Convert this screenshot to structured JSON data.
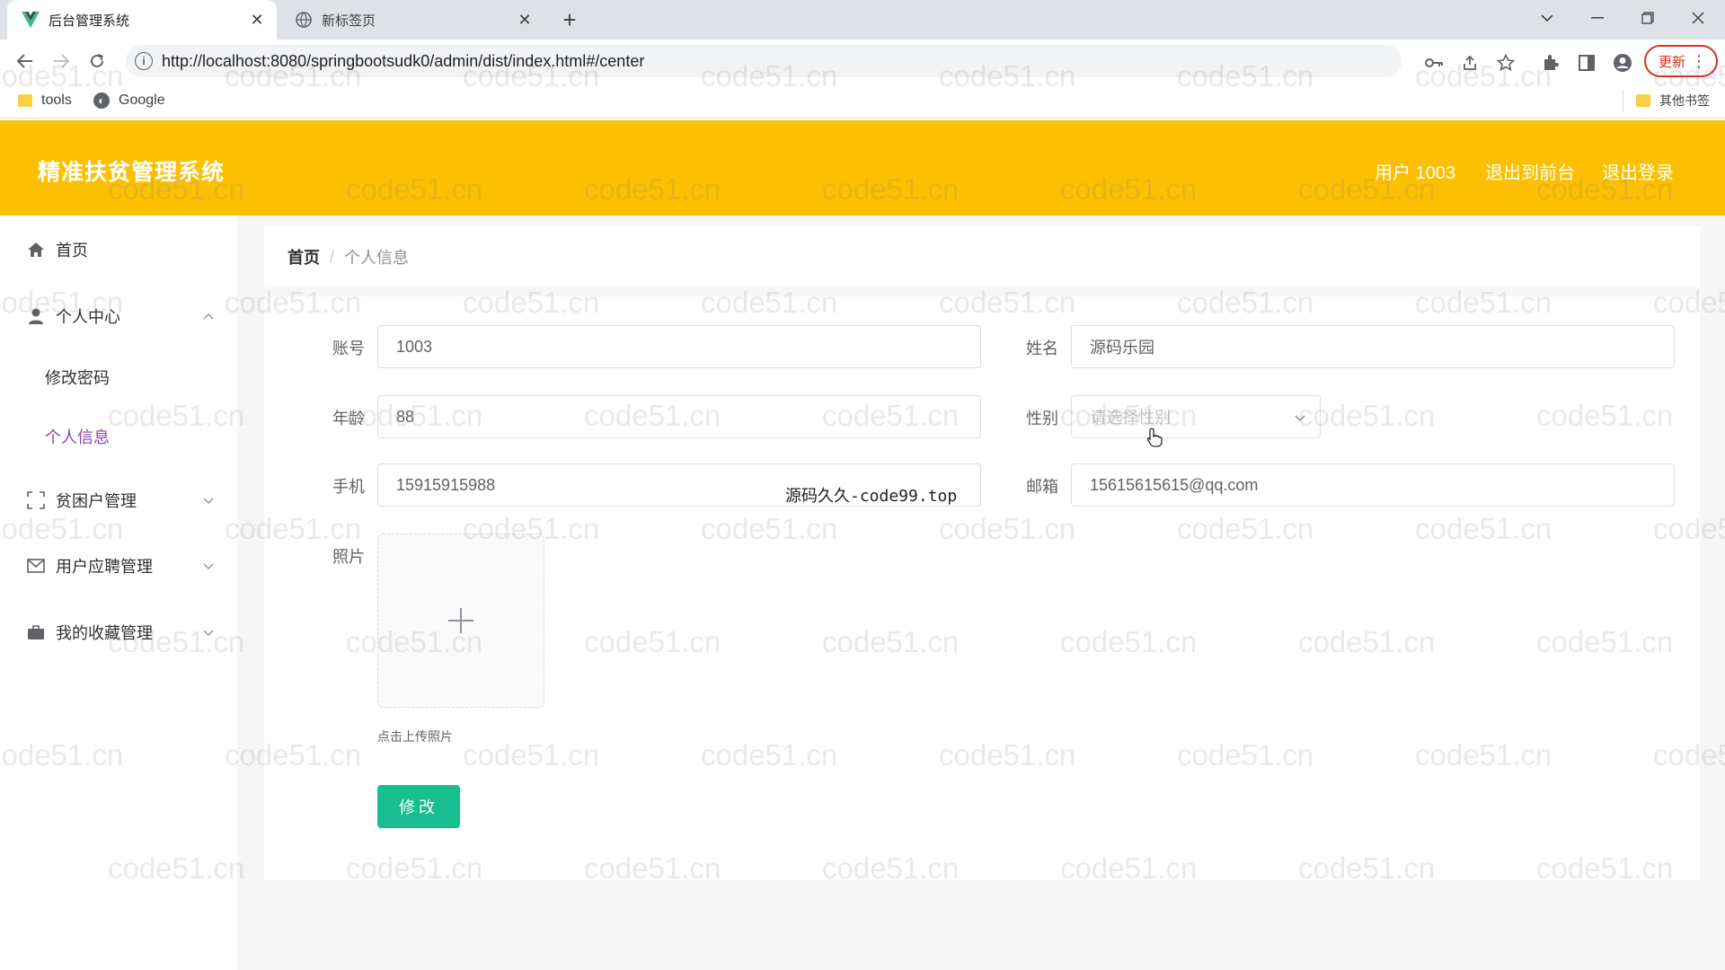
{
  "browser": {
    "tabs": [
      {
        "title": "后台管理系统",
        "active": true
      },
      {
        "title": "新标签页",
        "active": false
      }
    ],
    "url": "http://localhost:8080/springbootsudk0/admin/dist/index.html#/center",
    "update_label": "更新",
    "bookmarks": [
      {
        "label": "tools",
        "icon": "folder-icon"
      },
      {
        "label": "Google",
        "icon": "globe-icon"
      }
    ],
    "other_bookmarks": "其他书签"
  },
  "app": {
    "title": "精准扶贫管理系统",
    "header_links": {
      "user": "用户 1003",
      "to_front": "退出到前台",
      "logout": "退出登录"
    },
    "accent_color": "#fbc002"
  },
  "sidebar": {
    "items": [
      {
        "label": "首页",
        "icon": "home-icon"
      },
      {
        "label": "个人中心",
        "icon": "user-icon",
        "expanded": true,
        "children": [
          {
            "label": "修改密码"
          },
          {
            "label": "个人信息",
            "active": true
          }
        ]
      },
      {
        "label": "贫困户管理",
        "icon": "scan-icon"
      },
      {
        "label": "用户应聘管理",
        "icon": "mail-icon"
      },
      {
        "label": "我的收藏管理",
        "icon": "briefcase-icon"
      }
    ]
  },
  "breadcrumb": {
    "home": "首页",
    "separator": "/",
    "current": "个人信息"
  },
  "form": {
    "account": {
      "label": "账号",
      "value": "1003"
    },
    "name": {
      "label": "姓名",
      "value": "源码乐园"
    },
    "age": {
      "label": "年龄",
      "value": "88"
    },
    "gender": {
      "label": "性别",
      "placeholder": "请选择性别"
    },
    "phone": {
      "label": "手机",
      "value": "15915915988"
    },
    "email": {
      "label": "邮箱",
      "value": "15615615615@qq.com"
    },
    "photo": {
      "label": "照片",
      "tip": "点击上传照片"
    },
    "submit_label": "修改"
  },
  "overlay_text": "源码久久-code99.top",
  "watermark": "code51.cn",
  "submit_color": "#19be8f"
}
